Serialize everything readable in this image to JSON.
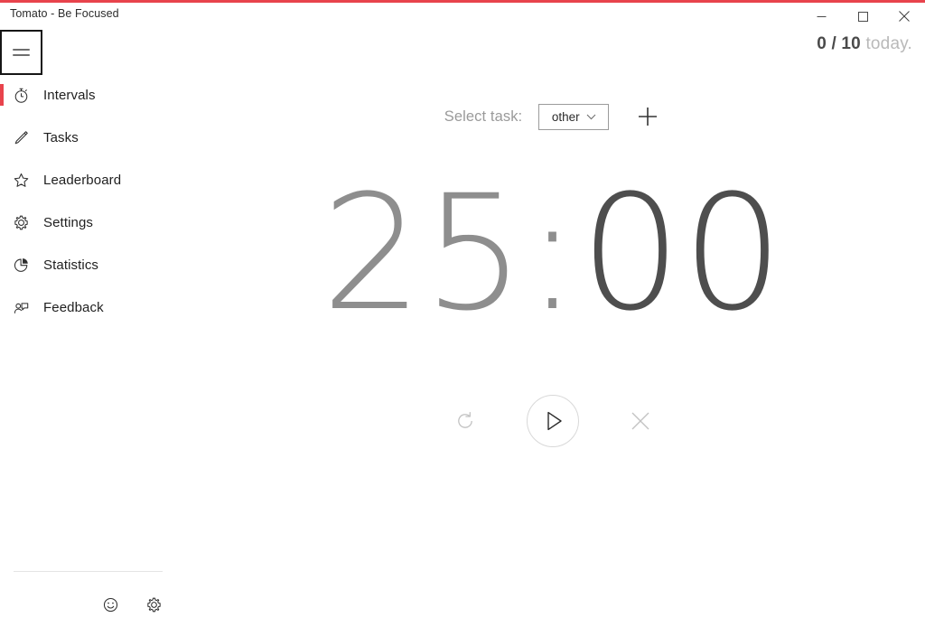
{
  "window": {
    "title": "Tomato - Be Focused",
    "accent_color": "#e8434c",
    "controls": {
      "minimize_label": "Minimize",
      "maximize_label": "Maximize",
      "close_label": "Close"
    }
  },
  "header": {
    "menu_button_label": "Menu",
    "counter": {
      "count": "0 / 10",
      "suffix": "today."
    }
  },
  "sidebar": {
    "items": [
      {
        "label": "Intervals",
        "icon": "stopwatch-icon",
        "active": true
      },
      {
        "label": "Tasks",
        "icon": "pencil-icon",
        "active": false
      },
      {
        "label": "Leaderboard",
        "icon": "star-icon",
        "active": false
      },
      {
        "label": "Settings",
        "icon": "gear-icon",
        "active": false
      },
      {
        "label": "Statistics",
        "icon": "pie-chart-icon",
        "active": false
      },
      {
        "label": "Feedback",
        "icon": "feedback-icon",
        "active": false
      }
    ],
    "footer": {
      "smiley_label": "Rate app",
      "settings_label": "Settings"
    }
  },
  "main": {
    "task_selector": {
      "label": "Select task:",
      "selected": "other",
      "add_label": "Add task"
    },
    "timer": {
      "minutes": "25",
      "separator": ":",
      "seconds": "00",
      "minutes_color": "#8e8e8e",
      "seconds_color": "#4e4e4e"
    },
    "controls": {
      "reset_label": "Reset",
      "play_label": "Start",
      "stop_label": "Stop"
    }
  }
}
